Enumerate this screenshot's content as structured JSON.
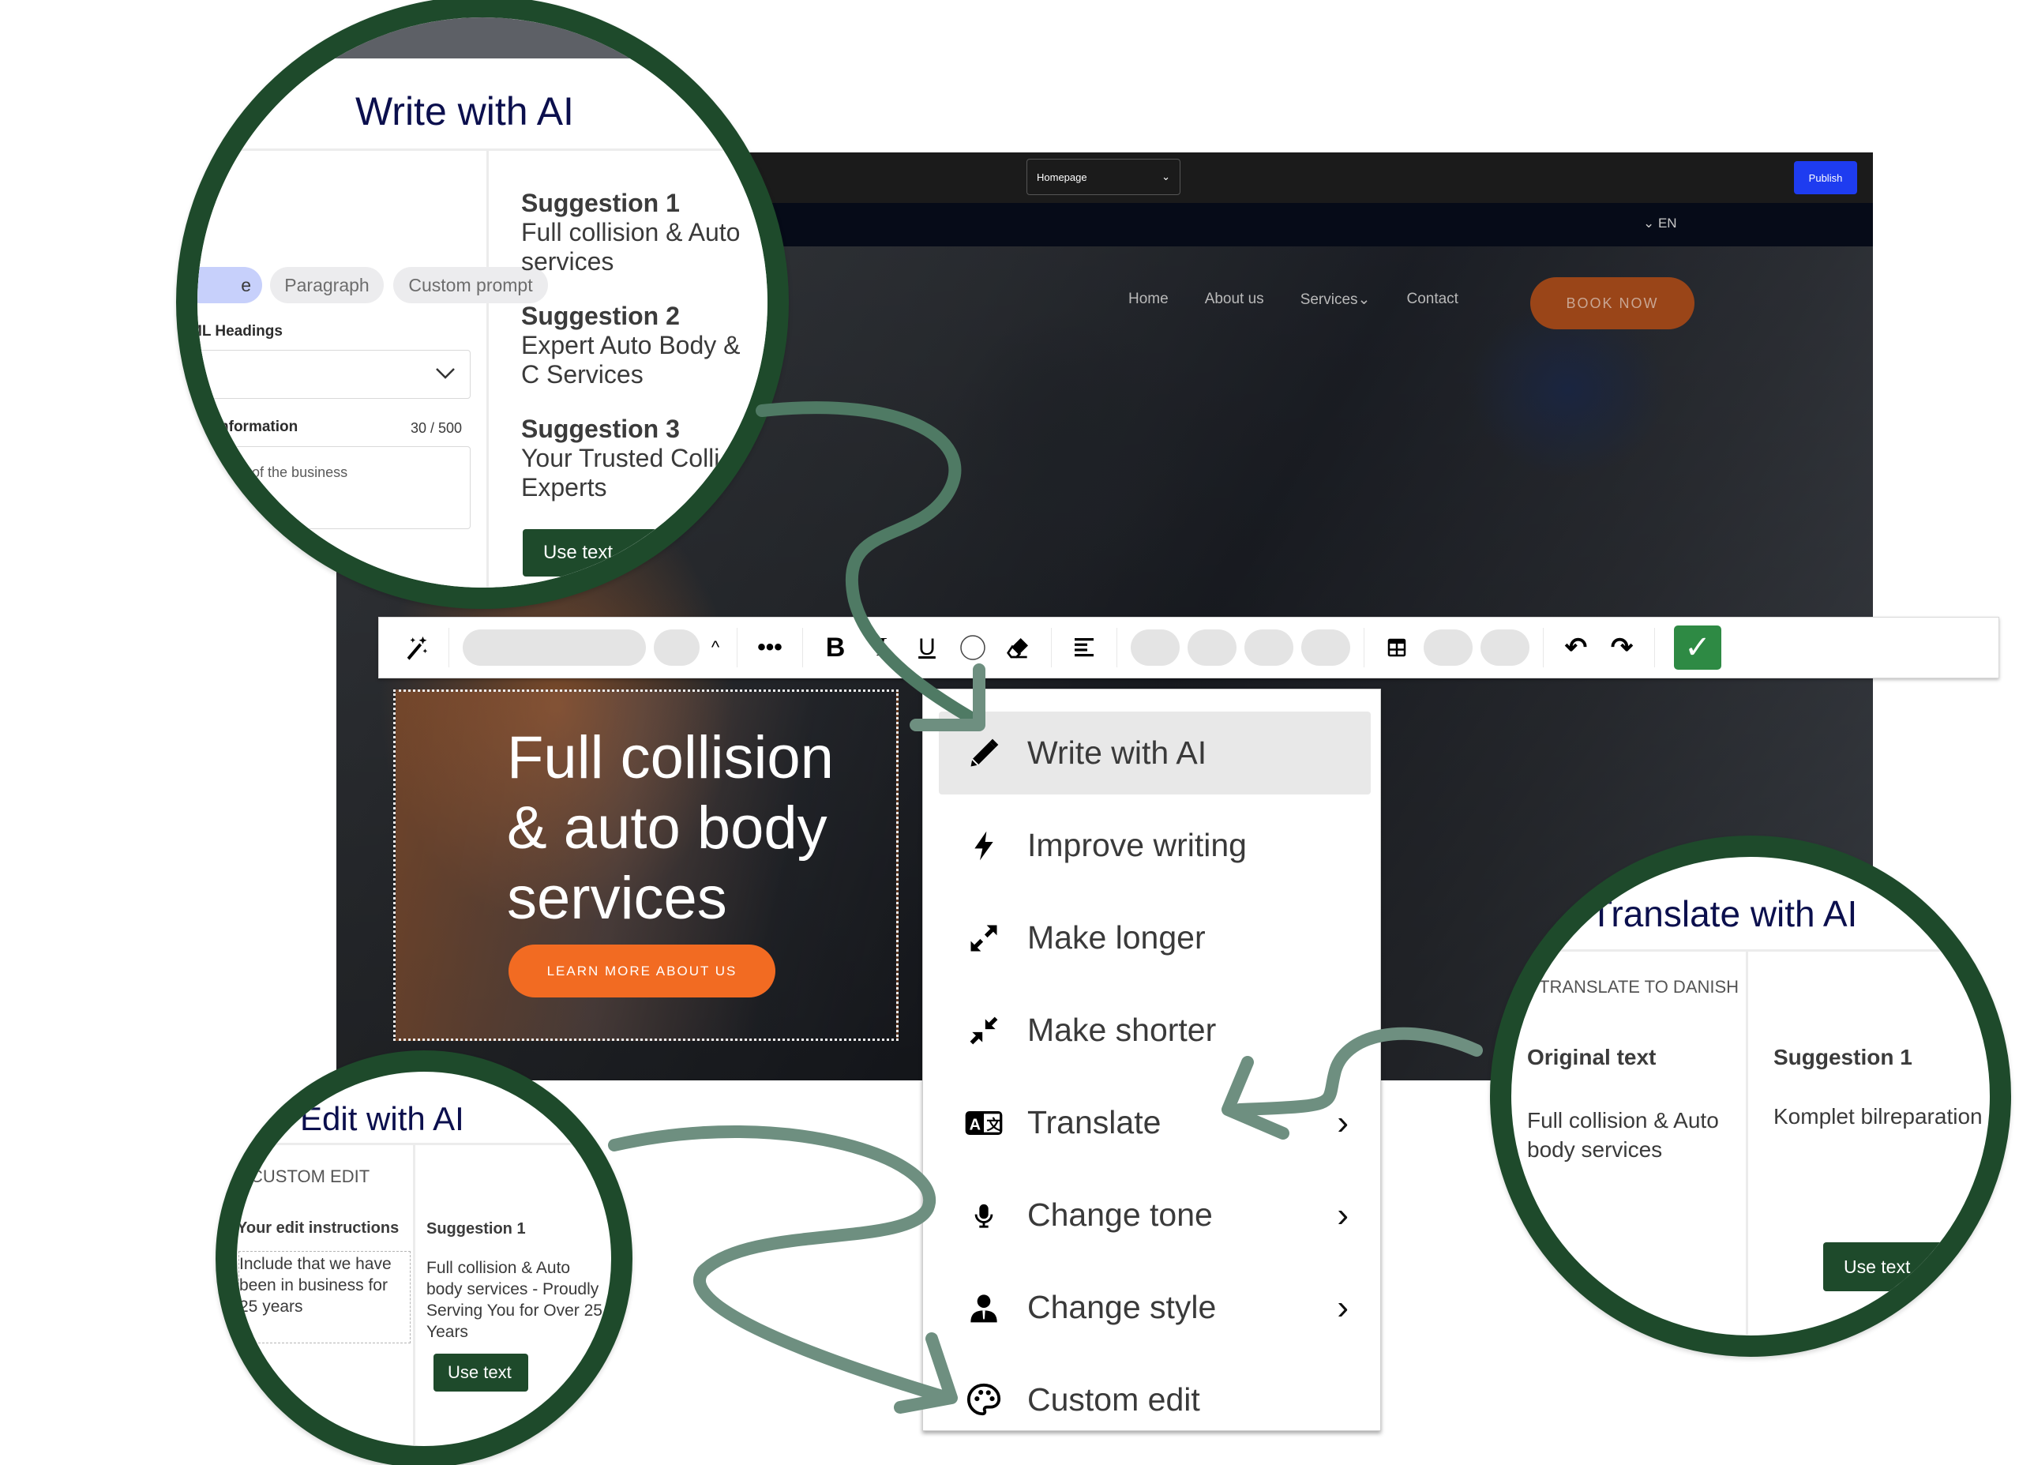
{
  "editor": {
    "page_selector": "Homepage",
    "publish_label": "Publish",
    "language": "EN"
  },
  "website": {
    "nav": [
      "Home",
      "About us",
      "Services",
      "Contact"
    ],
    "services_chevron": "⌄",
    "book_now": "BOOK NOW",
    "hero_title": "Full collision & auto body services",
    "learn_more": "LEARN MORE ABOUT US"
  },
  "toolbar": {
    "icons": {
      "ai_wand": "magic-wand",
      "more": "•••",
      "bold": "B",
      "italic": "I",
      "underline": "U",
      "color": "◯",
      "eraser": "eraser",
      "align": "≡",
      "table": "table",
      "undo": "↶",
      "redo": "↷",
      "confirm": "✓"
    },
    "caret_up": "^"
  },
  "ai_menu": {
    "items": [
      {
        "label": "Write with AI",
        "icon": "pencil",
        "submenu": false,
        "active": true
      },
      {
        "label": "Improve writing",
        "icon": "lightning",
        "submenu": false
      },
      {
        "label": "Make longer",
        "icon": "expand-arrows",
        "submenu": false
      },
      {
        "label": "Make shorter",
        "icon": "collapse-arrows",
        "submenu": false
      },
      {
        "label": "Translate",
        "icon": "translate",
        "submenu": true
      },
      {
        "label": "Change tone",
        "icon": "microphone",
        "submenu": true
      },
      {
        "label": "Change style",
        "icon": "person-tie",
        "submenu": true
      },
      {
        "label": "Custom edit",
        "icon": "palette",
        "submenu": false
      }
    ],
    "chevron": "›"
  },
  "write_panel": {
    "title": "Write with AI",
    "chips": [
      "e",
      "Paragraph",
      "Custom prompt"
    ],
    "headings_label": "ML Headings",
    "additional_label": "nal information",
    "counter": "30 / 500",
    "textarea_value": "n title of the business",
    "suggestions": [
      {
        "heading": "Suggestion 1",
        "text": "Full collision & Auto services"
      },
      {
        "heading": "Suggestion 2",
        "text": "Expert Auto Body & C Services"
      },
      {
        "heading": "Suggestion 3",
        "text": "Your Trusted Colli Experts"
      }
    ],
    "use_text": "Use text"
  },
  "edit_panel": {
    "title": "Edit with AI",
    "section": "CUSTOM EDIT",
    "instructions_label": "Your edit instructions",
    "instructions_value": "Include that we have been in business for 25 years",
    "suggestion_heading": "Suggestion 1",
    "suggestion_text": "Full collision & Auto body services - Proudly Serving You for Over 25 Years",
    "use_text": "Use text"
  },
  "translate_panel": {
    "title": "Translate with AI",
    "section": "TRANSLATE TO DANISH",
    "original_label": "Original text",
    "original_text": "Full collision & Auto body services",
    "suggestion_heading": "Suggestion 1",
    "suggestion_text": "Komplet bilreparation og vedligeholdelse",
    "use_text": "Use text"
  },
  "colors": {
    "ring_green": "#1e4a2b",
    "arrow_green": "#6e8f80",
    "publish_blue": "#1e3cf0",
    "cta_orange": "#f26b22",
    "title_navy": "#0b0f4d",
    "confirm_green": "#2e8a44"
  }
}
